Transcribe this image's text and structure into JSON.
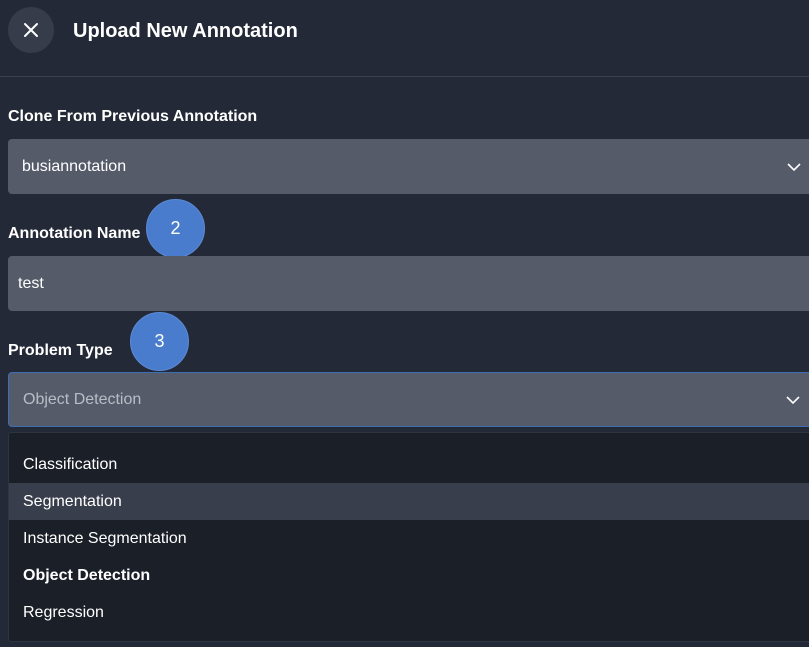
{
  "header": {
    "title": "Upload New Annotation",
    "close_icon": "close-icon"
  },
  "clone": {
    "label": "Clone From Previous Annotation",
    "value": "busiannotation"
  },
  "annotation_name": {
    "label": "Annotation Name",
    "value": "test",
    "step_badge": "2"
  },
  "problem_type": {
    "label": "Problem Type",
    "value": "Object Detection",
    "step_badge": "3",
    "options": [
      "Classification",
      "Segmentation",
      "Instance Segmentation",
      "Object Detection",
      "Regression"
    ],
    "hovered_option": "Segmentation",
    "selected_option": "Object Detection"
  },
  "colors": {
    "background": "#232936",
    "field": "#555b69",
    "dropdown": "#1a1f28",
    "badge": "#4a7ccd",
    "hover": "#383e4b"
  }
}
